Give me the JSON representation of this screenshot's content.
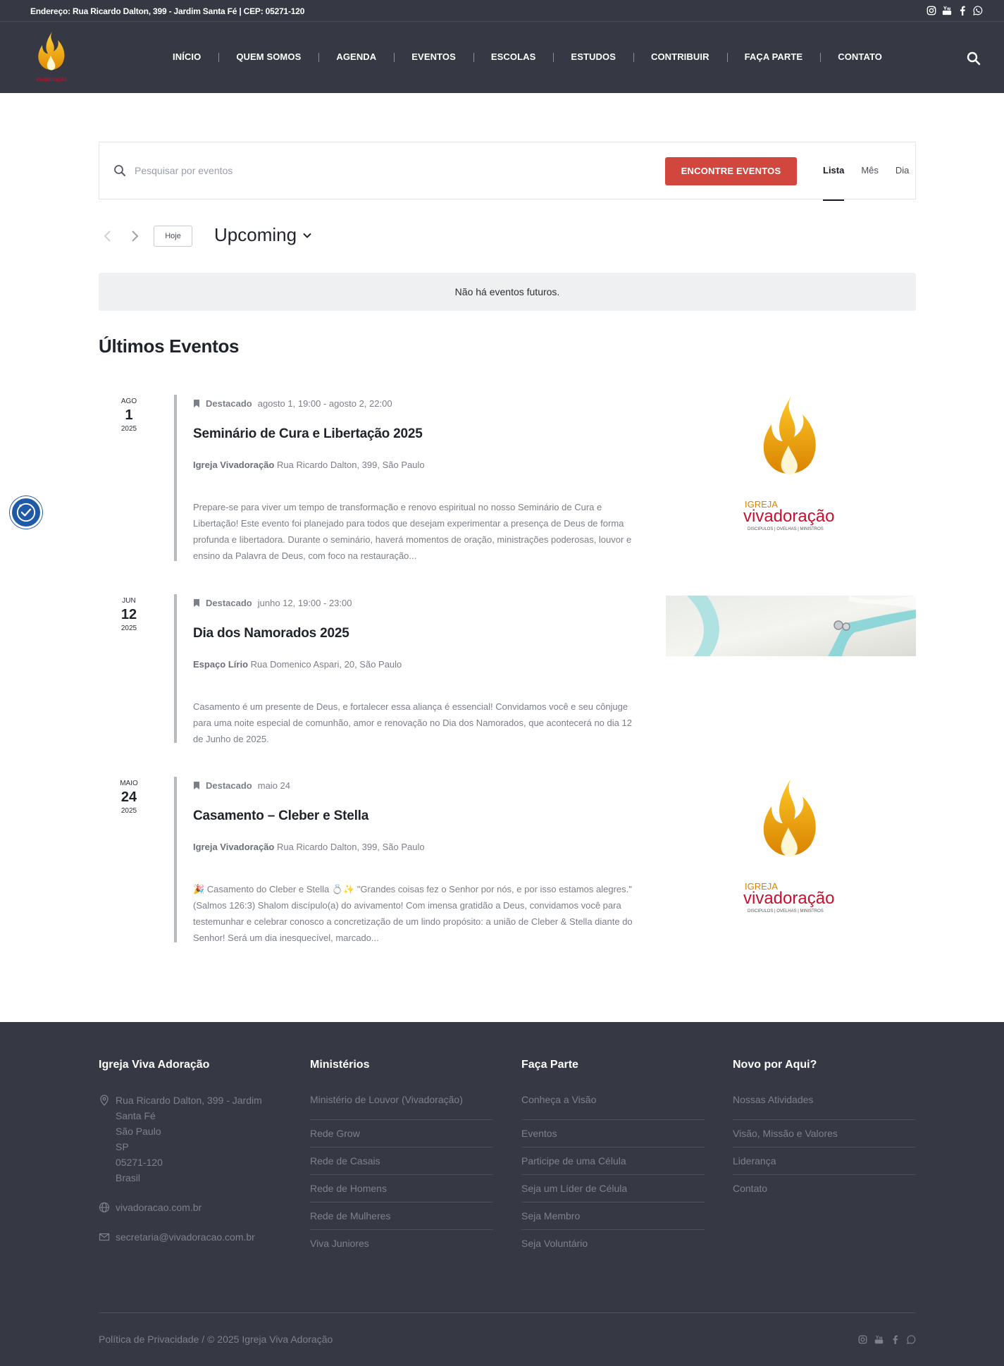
{
  "topbar": {
    "address": "Endereço: Rua Ricardo Dalton, 399 - Jardim Santa Fé | CEP: 05271-120",
    "social": [
      "instagram-icon",
      "youtube-icon",
      "facebook-icon",
      "whatsapp-icon"
    ]
  },
  "nav": {
    "items": [
      "INÍCIO",
      "QUEM SOMOS",
      "AGENDA",
      "EVENTOS",
      "ESCOLAS",
      "ESTUDOS",
      "CONTRIBUIR",
      "FAÇA PARTE",
      "CONTATO"
    ]
  },
  "search": {
    "placeholder": "Pesquisar por eventos",
    "button": "ENCONTRE EVENTOS",
    "views": [
      "Lista",
      "Mês",
      "Dia"
    ],
    "active_view": "Lista"
  },
  "toolbar": {
    "today": "Hoje",
    "range": "Upcoming"
  },
  "notice": "Não há eventos futuros.",
  "past_title": "Últimos Eventos",
  "events": [
    {
      "month": "AGO",
      "day": "1",
      "year": "2025",
      "featured": "Destacado",
      "when": "agosto 1, 19:00 - agosto 2, 22:00",
      "title": "Seminário de Cura e Libertação 2025",
      "venue": "Igreja Vivadoração",
      "address": "Rua Ricardo Dalton, 399, São Paulo",
      "description": "Prepare-se para viver um tempo de transformação e renovo espiritual no nosso Seminário de Cura e Libertação! Este evento foi planejado para todos que desejam experimentar a presença de Deus de forma profunda e libertadora. Durante o seminário, haverá momentos de oração, ministrações poderosas, louvor e ensino da Palavra de Deus, com foco na restauração...",
      "image": "logo"
    },
    {
      "month": "JUN",
      "day": "12",
      "year": "2025",
      "featured": "Destacado",
      "when": "junho 12, 19:00 - 23:00",
      "title": "Dia dos Namorados 2025",
      "venue": "Espaço Lírio",
      "address": "Rua Domenico Aspari, 20, São Paulo",
      "description": "Casamento é um presente de Deus, e fortalecer essa aliança é essencial! Convidamos você e seu cônjuge para uma noite especial de comunhão, amor e renovação no Dia dos Namorados, que acontecerá no dia 12 de Junho de 2025.",
      "image": "photo"
    },
    {
      "month": "MAIO",
      "day": "24",
      "year": "2025",
      "featured": "Destacado",
      "when": "maio 24",
      "title": "Casamento – Cleber e Stella",
      "venue": "Igreja Vivadoração",
      "address": "Rua Ricardo Dalton, 399, São Paulo",
      "description": "🎉 Casamento do Cleber e Stella 💍✨ \"Grandes coisas fez o Senhor por nós, e por isso estamos alegres.\" (Salmos 126:3) Shalom discípulo(a) do avivamento! Com imensa gratidão a Deus, convidamos você para testemunhar e celebrar conosco a concretização de um lindo propósito: a união de Cleber & Stella diante do Senhor! Será um dia inesquecível, marcado...",
      "image": "logo"
    }
  ],
  "logo_text": {
    "igreja": "IGREJA",
    "name": "vivadoração",
    "tagline": "DISCIPULOS | OVELHAS | MINISTROS"
  },
  "footer": {
    "col1": {
      "title": "Igreja Viva Adoração",
      "address_lines": [
        "Rua Ricardo Dalton, 399 - Jardim",
        "Santa Fé",
        "São Paulo",
        "SP",
        "05271-120",
        "Brasil"
      ],
      "website": "vivadoracao.com.br",
      "email": "secretaria@vivadoracao.com.br"
    },
    "col2": {
      "title": "Ministérios",
      "links": [
        "Ministério de Louvor (Vivadoração)",
        "Rede Grow",
        "Rede de Casais",
        "Rede de Homens",
        "Rede de Mulheres",
        "Viva Juniores"
      ]
    },
    "col3": {
      "title": "Faça Parte",
      "links": [
        "Conheça a Visão",
        "Eventos",
        "Participe de uma Célula",
        "Seja um Líder de Célula",
        "Seja Membro",
        "Seja Voluntário"
      ]
    },
    "col4": {
      "title": "Novo por Aqui?",
      "links": [
        "Nossas Atividades",
        "Visão, Missão e Valores",
        "Liderança",
        "Contato"
      ]
    },
    "copyright": "Política de Privacidade / © 2025 Igreja Viva Adoração"
  },
  "colors": {
    "dark": "#363944",
    "accent": "#d1473d",
    "flame": "#f2a516",
    "brand_red": "#c8102e"
  }
}
